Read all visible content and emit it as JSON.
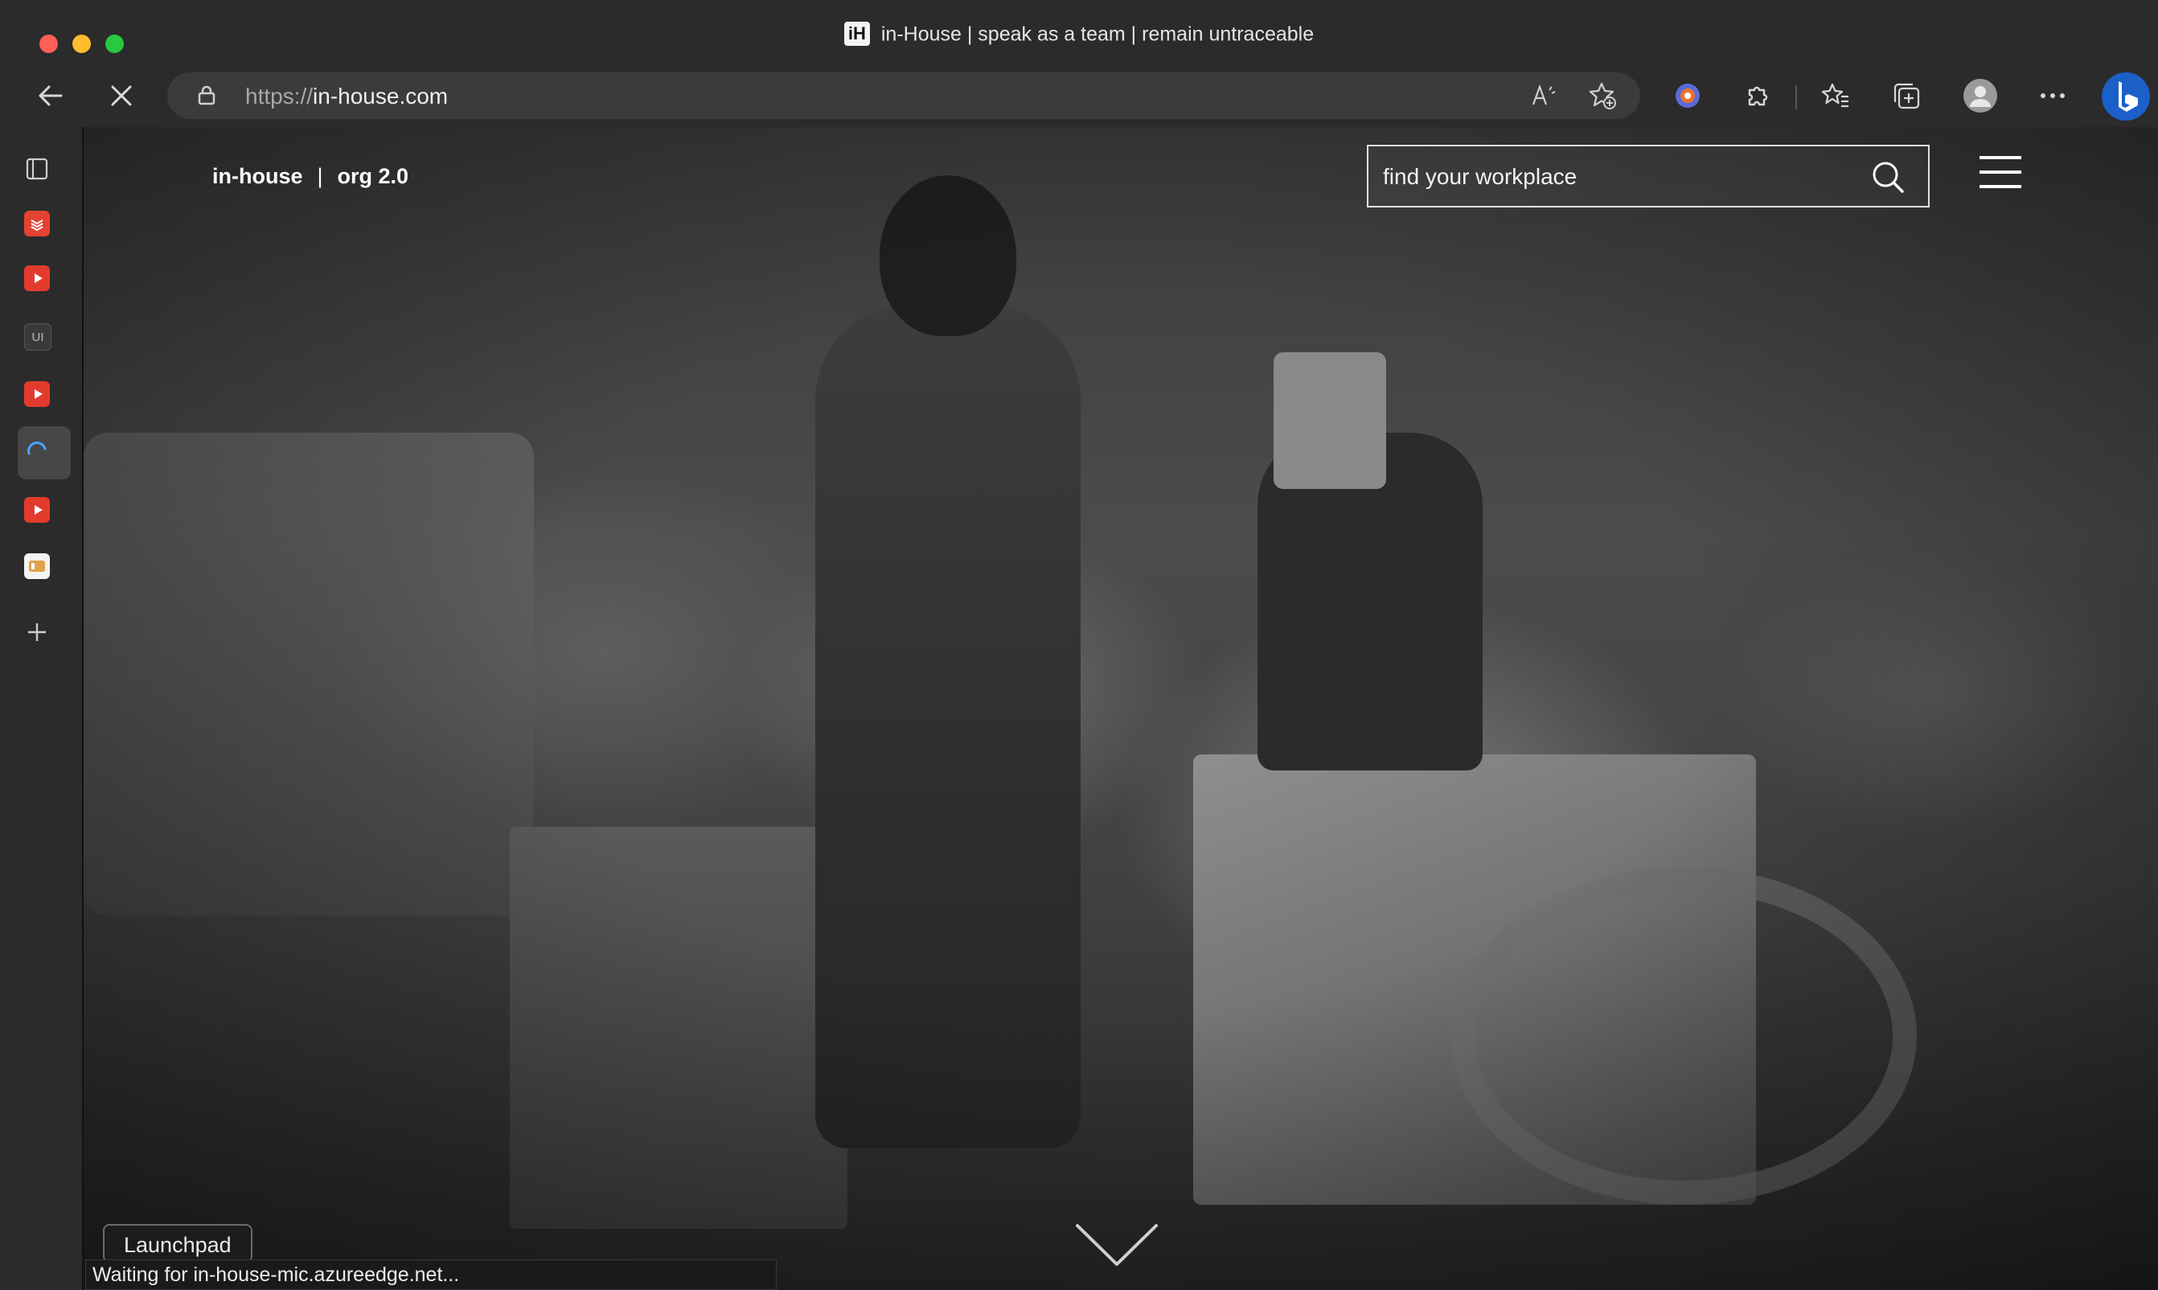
{
  "window": {
    "tab_title": "in-House | speak as a team | remain untraceable",
    "favicon_text": "iH"
  },
  "toolbar": {
    "url_protocol": "https://",
    "url_host": "in-house.com"
  },
  "page": {
    "brand_name": "in-house",
    "brand_separator": "|",
    "brand_version": "org 2.0",
    "search_placeholder": "find your workplace"
  },
  "overlays": {
    "tooltip": "Launchpad",
    "status": "Waiting for in-house-mic.azureedge.net..."
  },
  "colors": {
    "chrome_bg": "#2b2b2b",
    "address_bg": "#3b3b3b",
    "traffic_red": "#ff5f57",
    "traffic_yellow": "#febc2e",
    "traffic_green": "#28c840"
  }
}
